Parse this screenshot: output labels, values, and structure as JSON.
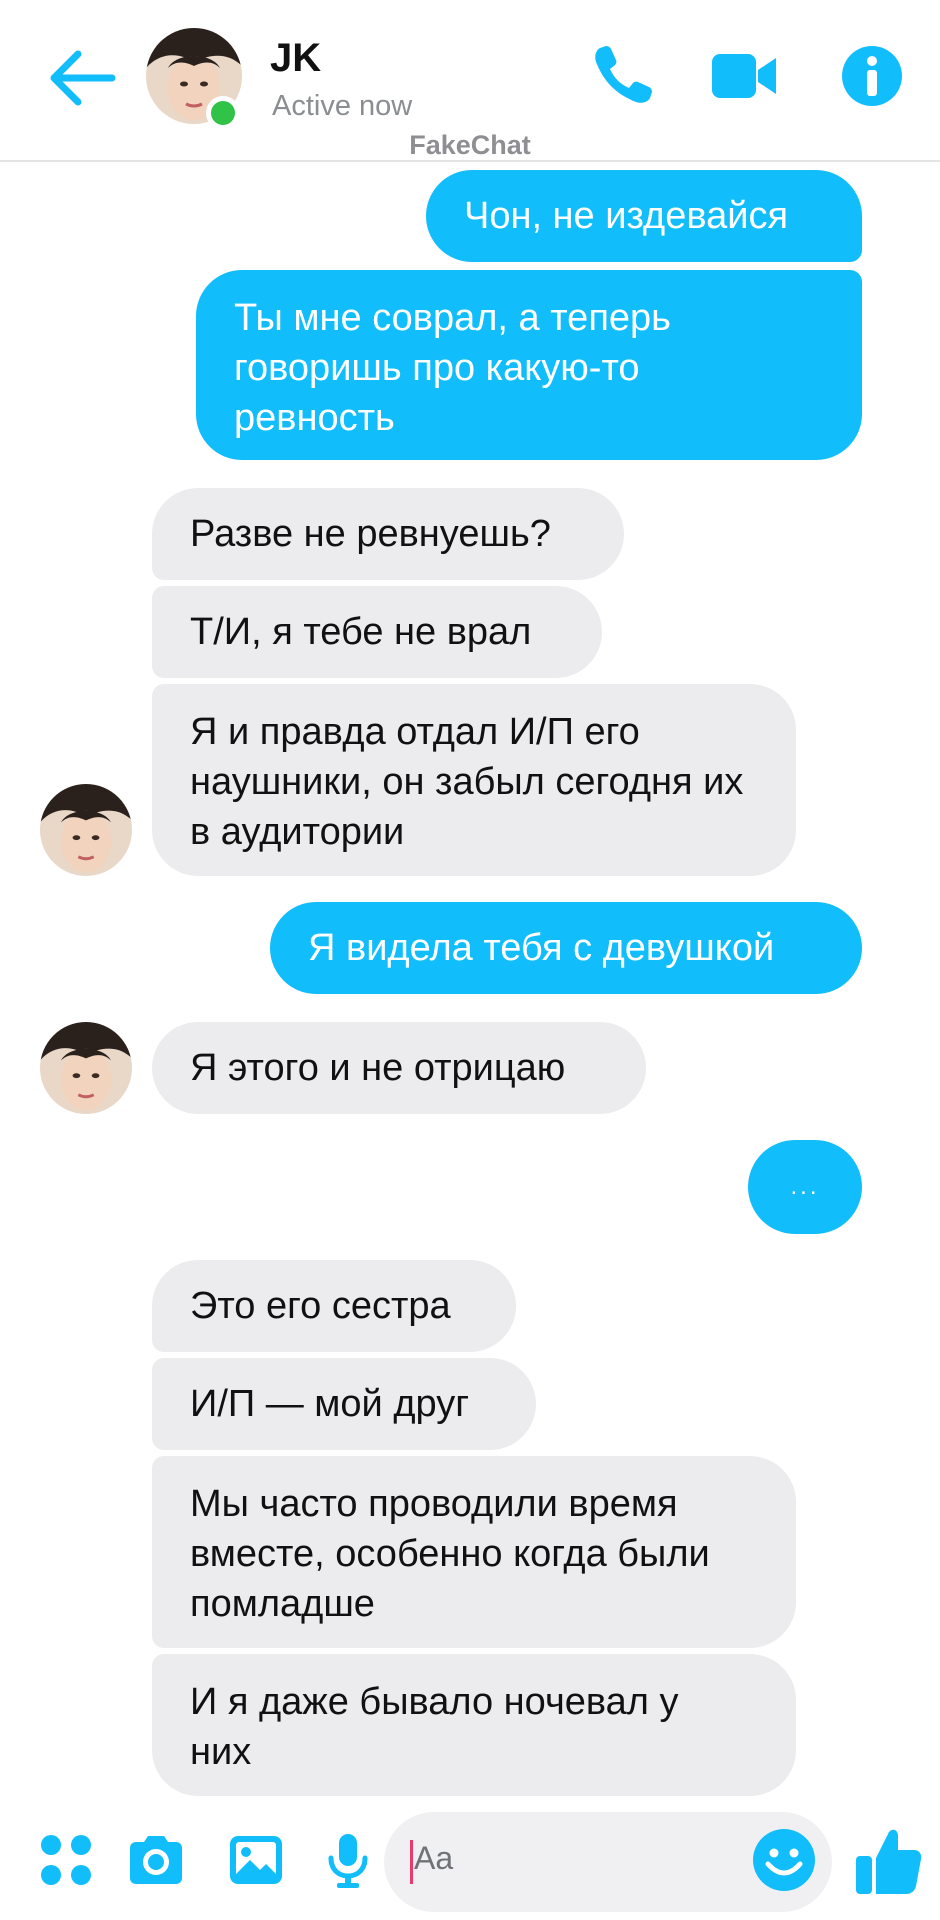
{
  "header": {
    "contact_name": "JK",
    "status": "Active now",
    "watermark": "FakeChat",
    "accent": "#12bdfb",
    "online_color": "#31c248"
  },
  "messages": [
    {
      "dir": "out",
      "text": "Чон, не издевайся"
    },
    {
      "dir": "out",
      "text": "Ты мне соврал, а теперь говоришь про какую-то ревность"
    },
    {
      "dir": "in",
      "text": "Разве не ревнуешь?"
    },
    {
      "dir": "in",
      "text": "Т/И, я тебе не врал"
    },
    {
      "dir": "in",
      "text": "Я и правда отдал И/П его наушники, он забыл сегодня их в аудитории"
    },
    {
      "dir": "out",
      "text": "Я видела тебя с девушкой"
    },
    {
      "dir": "in",
      "text": "Я этого и не отрицаю"
    },
    {
      "dir": "out",
      "text": "..."
    },
    {
      "dir": "in",
      "text": "Это его сестра"
    },
    {
      "dir": "in",
      "text": "И/П — мой друг"
    },
    {
      "dir": "in",
      "text": "Мы часто проводили время вместе, особенно когда были помладше"
    },
    {
      "dir": "in",
      "text": "И я даже бывало ночевал у них"
    }
  ],
  "composer": {
    "placeholder": "Aa",
    "icons": [
      "menu-dots-icon",
      "camera-icon",
      "gallery-icon",
      "microphone-icon",
      "emoji-icon",
      "thumbs-up-icon"
    ]
  }
}
